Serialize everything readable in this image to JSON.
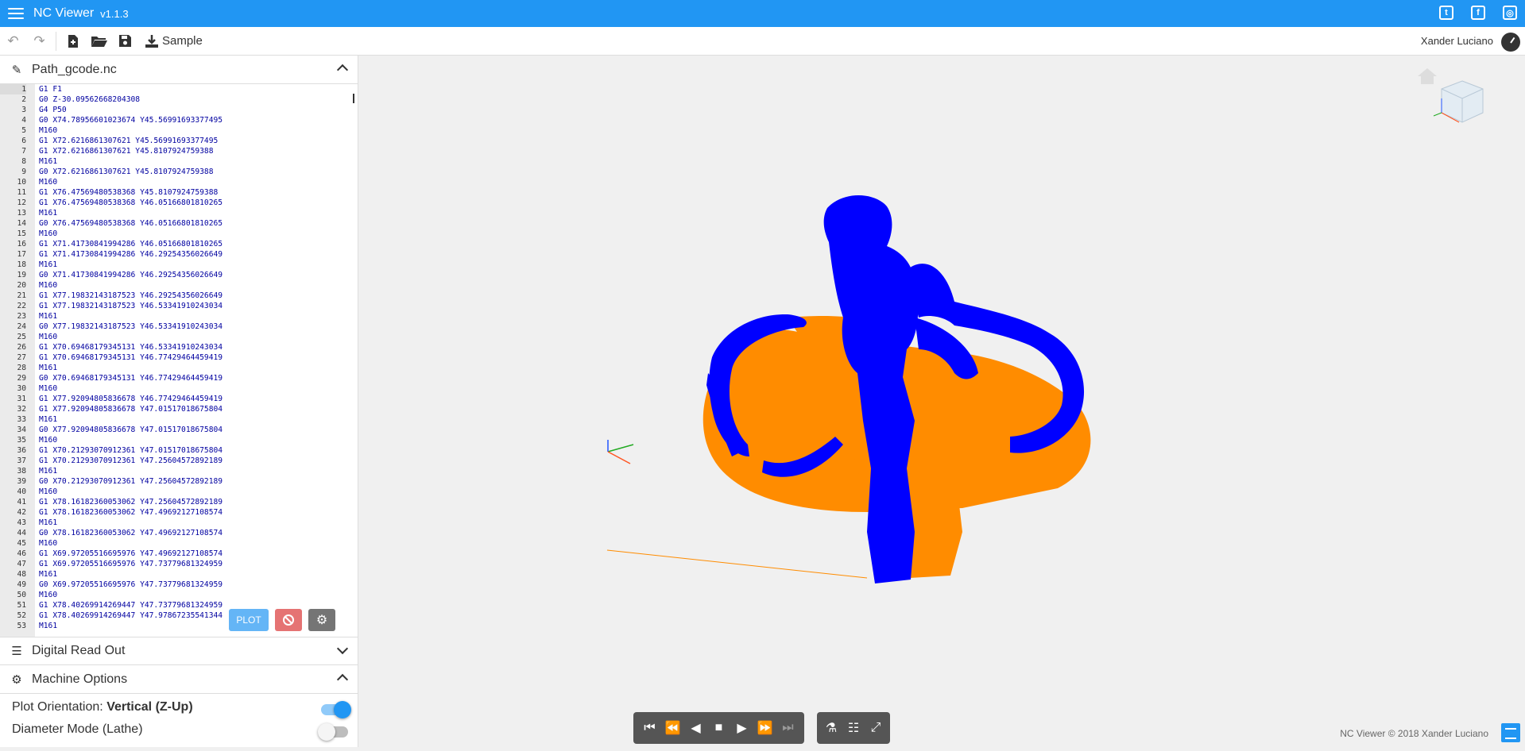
{
  "app": {
    "title": "NC Viewer",
    "version": "v1.1.3"
  },
  "social": {
    "twitter": "t",
    "facebook": "f",
    "instagram": "◎"
  },
  "toolbar": {
    "sample_label": "Sample",
    "user": "Xander Luciano"
  },
  "file_panel": {
    "title": "Path_gcode.nc"
  },
  "code_lines": [
    "G1 F1",
    "G0 Z-30.09562668204308",
    "G4 P50",
    "G0 X74.78956601023674 Y45.56991693377495",
    "M160",
    "G1 X72.6216861307621 Y45.56991693377495",
    "G1 X72.6216861307621 Y45.8107924759388",
    "M161",
    "G0 X72.6216861307621 Y45.8107924759388",
    "M160",
    "G1 X76.47569480538368 Y45.8107924759388",
    "G1 X76.47569480538368 Y46.05166801810265",
    "M161",
    "G0 X76.47569480538368 Y46.05166801810265",
    "M160",
    "G1 X71.41730841994286 Y46.05166801810265",
    "G1 X71.41730841994286 Y46.29254356026649",
    "M161",
    "G0 X71.41730841994286 Y46.29254356026649",
    "M160",
    "G1 X77.19832143187523 Y46.29254356026649",
    "G1 X77.19832143187523 Y46.53341910243034",
    "M161",
    "G0 X77.19832143187523 Y46.53341910243034",
    "M160",
    "G1 X70.69468179345131 Y46.53341910243034",
    "G1 X70.69468179345131 Y46.77429464459419",
    "M161",
    "G0 X70.69468179345131 Y46.77429464459419",
    "M160",
    "G1 X77.92094805836678 Y46.77429464459419",
    "G1 X77.92094805836678 Y47.01517018675804",
    "M161",
    "G0 X77.92094805836678 Y47.01517018675804",
    "M160",
    "G1 X70.21293070912361 Y47.01517018675804",
    "G1 X70.21293070912361 Y47.25604572892189",
    "M161",
    "G0 X70.21293070912361 Y47.25604572892189",
    "M160",
    "G1 X78.16182360053062 Y47.25604572892189",
    "G1 X78.16182360053062 Y47.49692127108574",
    "M161",
    "G0 X78.16182360053062 Y47.49692127108574",
    "M160",
    "G1 X69.97205516695976 Y47.49692127108574",
    "G1 X69.97205516695976 Y47.73779681324959",
    "M161",
    "G0 X69.97205516695976 Y47.73779681324959",
    "M160",
    "G1 X78.40269914269447 Y47.73779681324959",
    "G1 X78.40269914269447 Y47.97867235541344",
    "M161"
  ],
  "buttons": {
    "plot": "PLOT"
  },
  "panels": {
    "dro": "Digital Read Out",
    "machine_options": "Machine Options"
  },
  "options": {
    "orientation_label": "Plot Orientation:",
    "orientation_value": "Vertical (Z-Up)",
    "orientation_on": true,
    "diameter_label": "Diameter Mode (Lathe)",
    "diameter_on": false
  },
  "colors": {
    "accent": "#2196f3",
    "feed": "#0000ff",
    "rapid": "#ff8c00"
  },
  "footer": "NC Viewer © 2018 Xander Luciano"
}
